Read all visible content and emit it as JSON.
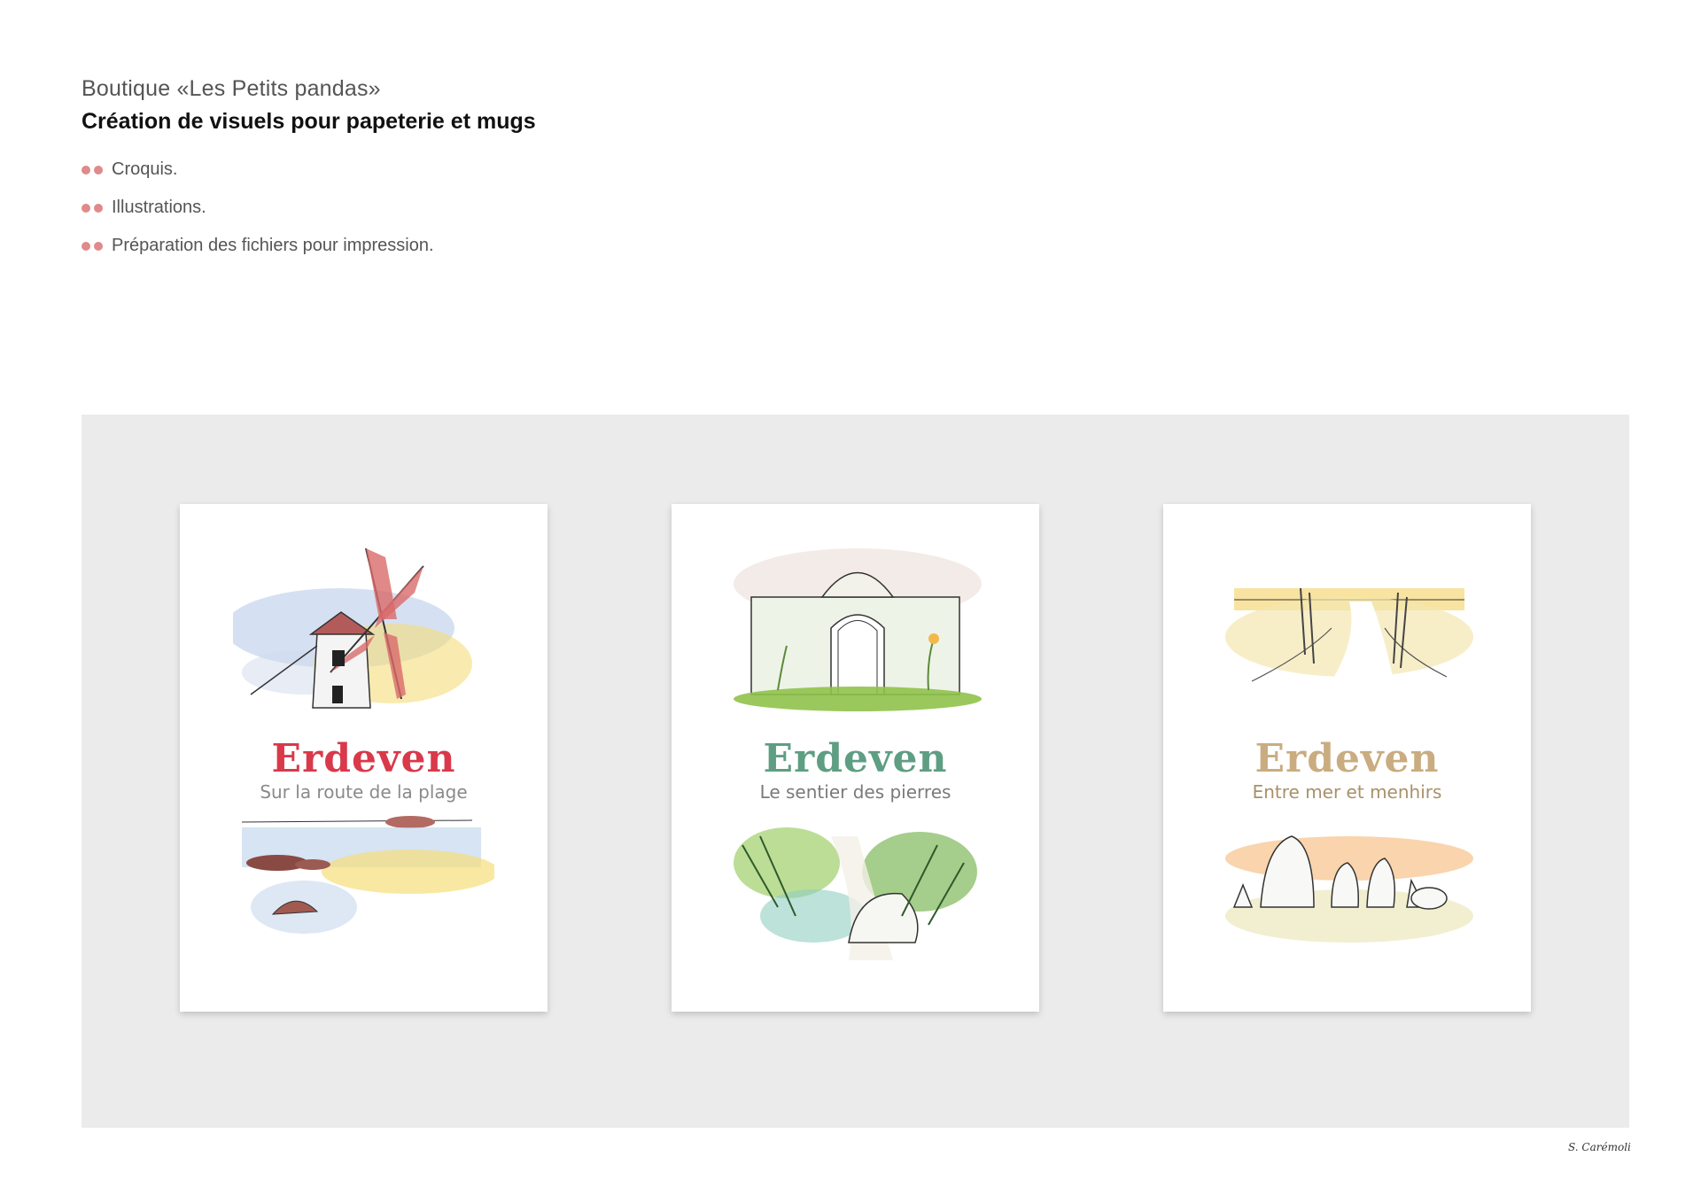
{
  "header": {
    "subtitle": "Boutique «Les Petits pandas»",
    "title": "Création de visuels pour papeterie et mugs",
    "bullets": [
      "Croquis.",
      "Illustrations.",
      "Préparation des fichiers pour impression."
    ],
    "bullet_color": "#e08a8a"
  },
  "cards": [
    {
      "place": "Erdeven",
      "tagline": "Sur la route de la plage",
      "place_color": "#d9394a",
      "tagline_color": "#8a8a8a",
      "top_icon": "windmill-illustration",
      "bottom_icon": "beach-rocks-illustration"
    },
    {
      "place": "Erdeven",
      "tagline": "Le sentier des pierres",
      "place_color": "#5e9e83",
      "tagline_color": "#7a7a7a",
      "top_icon": "stone-archway-illustration",
      "bottom_icon": "forest-path-stone-illustration"
    },
    {
      "place": "Erdeven",
      "tagline": "Entre mer et menhirs",
      "place_color": "#c9ac80",
      "tagline_color": "#a8916a",
      "top_icon": "dune-path-sunset-illustration",
      "bottom_icon": "menhirs-illustration"
    }
  ],
  "footer": {
    "signature": "S. Carémoli"
  },
  "colors": {
    "panel_bg": "#ebebeb",
    "page_bg": "#ffffff"
  }
}
